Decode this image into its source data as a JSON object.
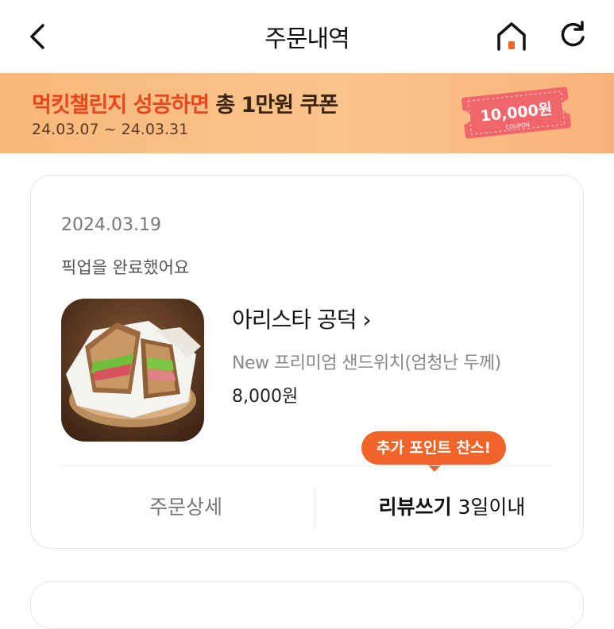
{
  "header": {
    "title": "주문내역",
    "back_icon": "chevron-left-icon",
    "home_icon": "home-icon",
    "refresh_icon": "refresh-icon"
  },
  "banner": {
    "title_highlight": "먹킷챌린지 성공하면",
    "title_rest": " 총 1만원 쿠폰",
    "period": "24.03.07 ~ 24.03.31",
    "coupon_amount": "10,000원",
    "coupon_label": "COUPON",
    "colors": {
      "highlight": "#e8461e",
      "coupon": "#f1666a"
    }
  },
  "order": {
    "date": "2024.03.19",
    "status": "픽업을 완료했어요",
    "store_name": "아리스타 공덕",
    "store_chevron": "›",
    "menu": "New 프리미엄 샌드위치(엄청난 두께)",
    "price": "8,000원",
    "tooltip": "추가 포인트 찬스!",
    "detail_label": "주문상세",
    "review_label": "리뷰쓰기",
    "review_deadline": " 3일이내"
  },
  "accent_color": "#f0642a"
}
